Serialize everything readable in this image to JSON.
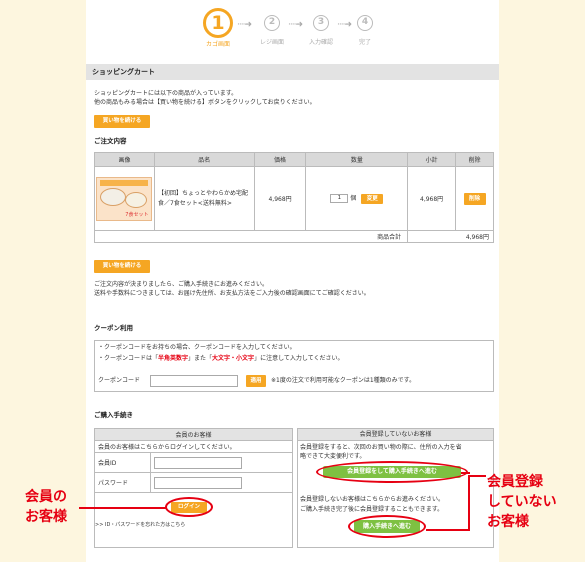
{
  "steps": [
    {
      "num": "1",
      "label": "カゴ画面"
    },
    {
      "num": "2",
      "label": "レジ画面"
    },
    {
      "num": "3",
      "label": "入力確認"
    },
    {
      "num": "4",
      "label": "完了"
    }
  ],
  "arrow": "····➜",
  "header": "ショッピングカート",
  "intro1": "ショッピングカートには以下の商品が入っています。",
  "intro2": "他の商品もみる場合は【買い物を続ける】ボタンをクリックしてお戻りください。",
  "continue_btn": "買い物を続ける",
  "order_title": "ご注文内容",
  "cols": [
    "画像",
    "品名",
    "価格",
    "数量",
    "小計",
    "削除"
  ],
  "item": {
    "name": "【初回】ちょっとやわらかめ宅配食／7食セット<送料無料>",
    "price": "4,968円",
    "qty": "1",
    "unit": "個",
    "update": "変更",
    "subtotal": "4,968円",
    "delete": "削除",
    "thumb_top": "ちょっとやわらかめ宅配食",
    "thumb_tag": "7食セット"
  },
  "total_label": "商品合計",
  "total_value": "4,968円",
  "after1": "ご注文内容が決まりましたら、ご購入手続きにお進みください。",
  "after2": "送料や手数料につきましては、お届け先住所、お支払方法をご入力後の確認画面にてご確認ください。",
  "coupon_title": "クーポン利用",
  "coupon1": "・クーポンコードをお持ちの場合、クーポンコードを入力してください。",
  "coupon2a": "・クーポンコードは「",
  "coupon2b": "半角英数字",
  "coupon2c": "」また「",
  "coupon2d": "大文字・小文字",
  "coupon2e": "」に注意して入力してください。",
  "coupon_label": "クーポンコード",
  "coupon_apply": "適用",
  "coupon_note": "※1度の注文で利用可能なクーポンは1種類のみです。",
  "purchase_title": "ご購入手続き",
  "member": {
    "header": "会員のお客様",
    "desc": "会員のお客様はこちらからログインしてください。",
    "id_label": "会員ID",
    "pw_label": "パスワード",
    "login": "ログイン",
    "forgot": ">> ID・パスワードを忘れた方はこちら"
  },
  "guest": {
    "header": "会員登録していないお客様",
    "desc1": "会員登録をすると、次回のお買い物の際に、住所の入力を省",
    "desc2": "略できて大変便利です。",
    "register": "会員登録をして購入手続きへ進む",
    "desc3": "会員登録しないお客様はこちらからお進みください。",
    "desc4": "ご購入手続き完了後に会員登録することもできます。",
    "proceed": "購入手続きへ進む"
  },
  "callout_member": [
    "会員の",
    "お客様"
  ],
  "callout_guest": [
    "会員登録",
    "していない",
    "お客様"
  ],
  "colors": {
    "accent": "#f5a623",
    "green": "#7ec142",
    "red": "#e60012",
    "background": "#fdf6df"
  }
}
